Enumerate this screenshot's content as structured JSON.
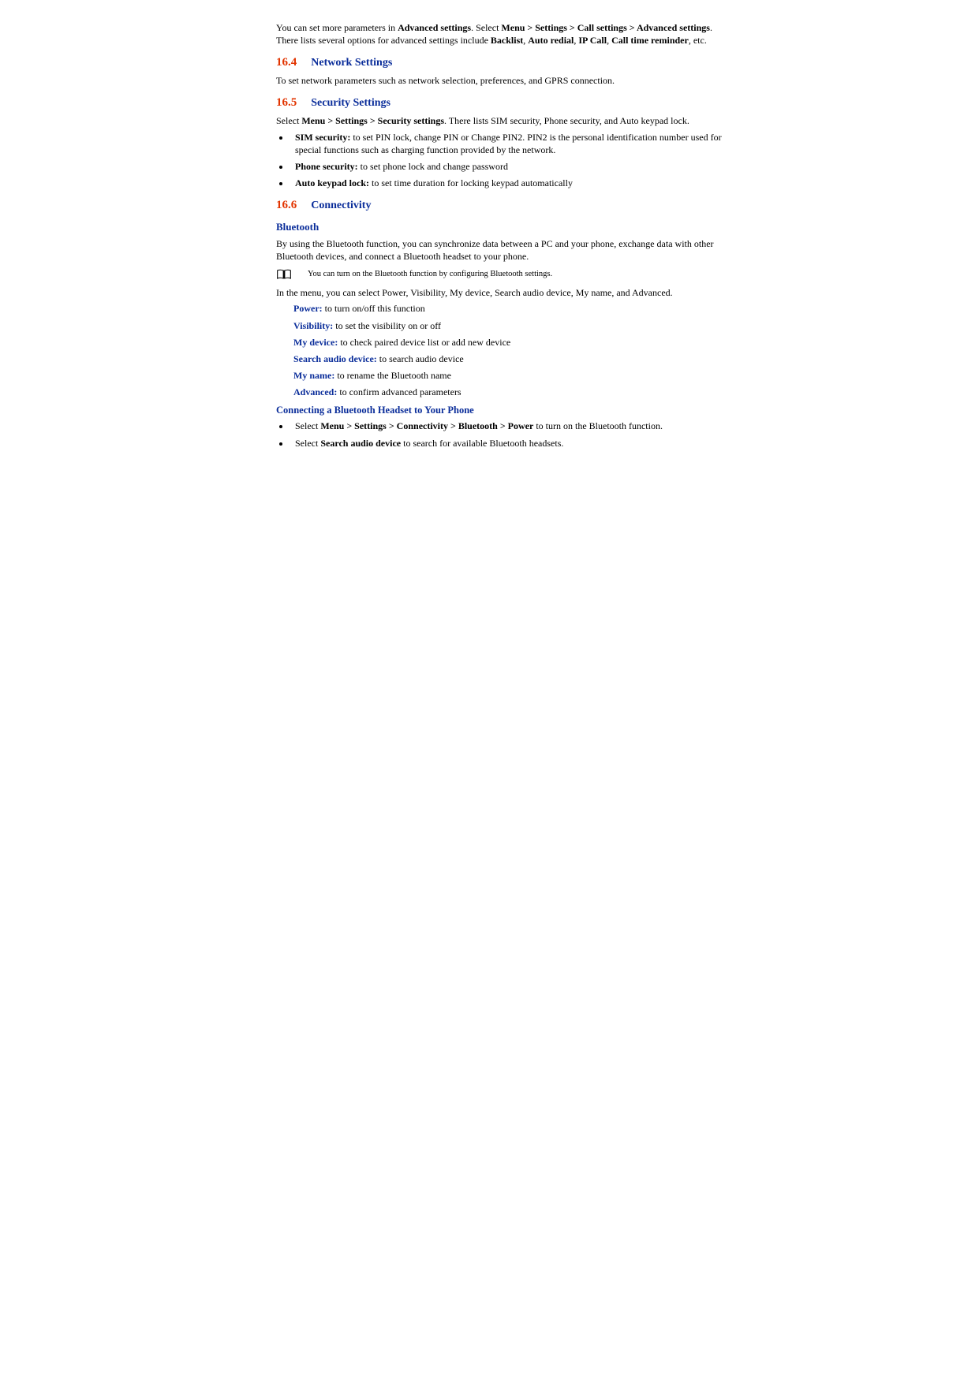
{
  "intro": {
    "t1": "You can set more parameters in ",
    "b1": "Advanced settings",
    "t2": ". Select ",
    "b2": "Menu > Settings > Call settings > Advanced settings",
    "t3": ". There lists several options for advanced settings include ",
    "b3": "Backlist",
    "t4": ", ",
    "b4": "Auto redial",
    "t5": ", ",
    "b5": "IP Call",
    "t6": ", ",
    "b6": "Call time reminder",
    "t7": ", etc."
  },
  "s164": {
    "num": "16.4",
    "title": "Network Settings",
    "body": "To set network parameters such as network selection, preferences, and GPRS connection."
  },
  "s165": {
    "num": "16.5",
    "title": "Security Settings",
    "lead_t1": "Select ",
    "lead_b1": "Menu > Settings > Security settings",
    "lead_t2": ". There lists SIM security, Phone security, and Auto keypad lock.",
    "items": [
      {
        "term": "SIM security:",
        "desc": " to set PIN lock, change PIN or Change PIN2. PIN2 is the personal identification number used for special functions such as charging function provided by the network."
      },
      {
        "term": "Phone security:",
        "desc": " to set phone lock and change password"
      },
      {
        "term": "Auto keypad lock:",
        "desc": " to set time duration for locking keypad automatically"
      }
    ]
  },
  "s166": {
    "num": "16.6",
    "title": "Connectivity",
    "bt_heading": "Bluetooth",
    "bt_body": "By using the Bluetooth function, you can synchronize data between a PC and your phone, exchange data with other Bluetooth devices, and connect a Bluetooth headset to your phone.",
    "note": "You can turn on the Bluetooth function by configuring Bluetooth settings.",
    "menu_lead": "In the menu, you can select Power, Visibility, My device, Search audio device, My name, and Advanced.",
    "defs": [
      {
        "term": "Power:",
        "desc": " to turn on/off this function"
      },
      {
        "term": "Visibility:",
        "desc": " to set the visibility on or off"
      },
      {
        "term": "My device:",
        "desc": " to check paired device list or add new device"
      },
      {
        "term": "Search audio device:",
        "desc": " to search audio device"
      },
      {
        "term": "My name:",
        "desc": " to rename the Bluetooth name"
      },
      {
        "term": "Advanced:",
        "desc": " to confirm advanced parameters"
      }
    ],
    "connect_heading": "Connecting a Bluetooth Headset to Your Phone",
    "steps": [
      {
        "t1": "Select ",
        "b1": "Menu > Settings > Connectivity > Bluetooth > Power",
        "t2": " to turn on the Bluetooth function."
      },
      {
        "t1": "Select ",
        "b1": "Search audio device",
        "t2": " to search for available Bluetooth headsets."
      }
    ]
  }
}
